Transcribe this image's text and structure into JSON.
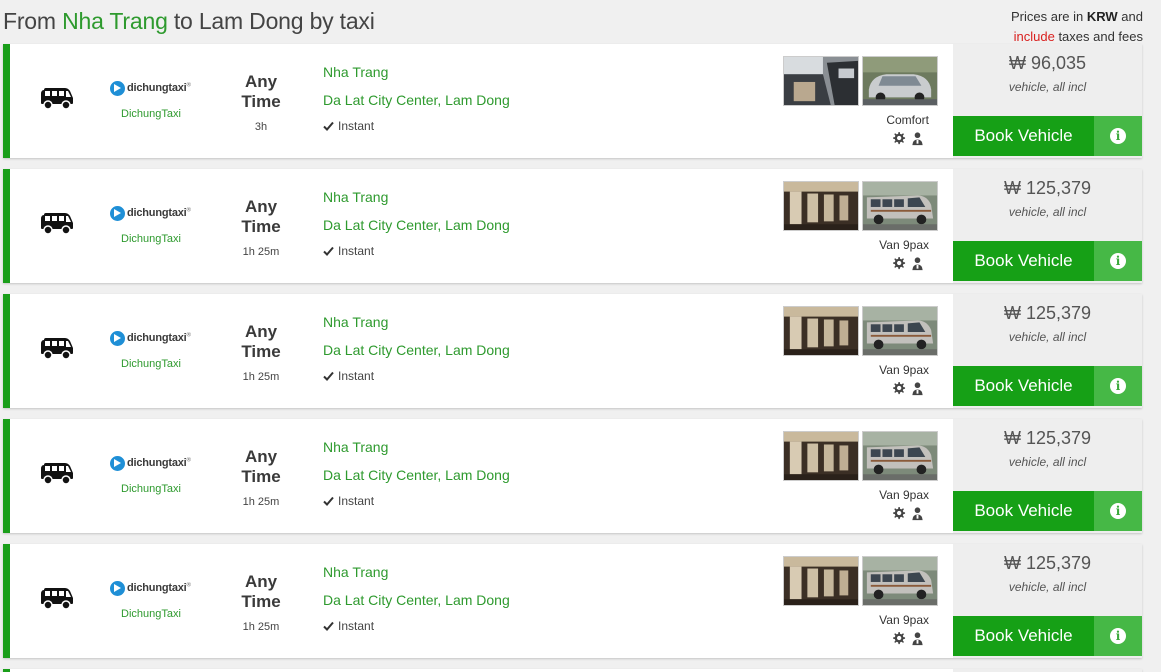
{
  "header": {
    "title_prefix": "From ",
    "origin": "Nha Trang",
    "title_middle": " to ",
    "destination": "Lam Dong",
    "title_suffix": " by taxi",
    "note_prefix": "Prices are in ",
    "currency": "KRW",
    "note_and": " and",
    "note_include": "include",
    "note_suffix": " taxes and fees"
  },
  "colors": {
    "accent_green": "#1a9e1a",
    "link_green": "#2e9a2e",
    "include_red": "#d9201f",
    "info_green": "#46b846"
  },
  "results": [
    {
      "operator_logo": "dichungtaxi",
      "operator_name": "DichungTaxi",
      "time_line1": "Any",
      "time_line2": "Time",
      "duration": "3h",
      "from": "Nha Trang",
      "to": "Da Lat City Center, Lam Dong",
      "instant": "Instant",
      "vehicle_class": "Comfort",
      "price": "₩ 96,035",
      "price_note": "vehicle, all incl",
      "book_label": "Book Vehicle",
      "photo1": "car-interior",
      "photo2": "sedan-exterior"
    },
    {
      "operator_logo": "dichungtaxi",
      "operator_name": "DichungTaxi",
      "time_line1": "Any",
      "time_line2": "Time",
      "duration": "1h 25m",
      "from": "Nha Trang",
      "to": "Da Lat City Center, Lam Dong",
      "instant": "Instant",
      "vehicle_class": "Van 9pax",
      "price": "₩ 125,379",
      "price_note": "vehicle, all incl",
      "book_label": "Book Vehicle",
      "photo1": "van-interior",
      "photo2": "van-exterior"
    },
    {
      "operator_logo": "dichungtaxi",
      "operator_name": "DichungTaxi",
      "time_line1": "Any",
      "time_line2": "Time",
      "duration": "1h 25m",
      "from": "Nha Trang",
      "to": "Da Lat City Center, Lam Dong",
      "instant": "Instant",
      "vehicle_class": "Van 9pax",
      "price": "₩ 125,379",
      "price_note": "vehicle, all incl",
      "book_label": "Book Vehicle",
      "photo1": "van-interior",
      "photo2": "van-exterior"
    },
    {
      "operator_logo": "dichungtaxi",
      "operator_name": "DichungTaxi",
      "time_line1": "Any",
      "time_line2": "Time",
      "duration": "1h 25m",
      "from": "Nha Trang",
      "to": "Da Lat City Center, Lam Dong",
      "instant": "Instant",
      "vehicle_class": "Van 9pax",
      "price": "₩ 125,379",
      "price_note": "vehicle, all incl",
      "book_label": "Book Vehicle",
      "photo1": "van-interior",
      "photo2": "van-exterior"
    },
    {
      "operator_logo": "dichungtaxi",
      "operator_name": "DichungTaxi",
      "time_line1": "Any",
      "time_line2": "Time",
      "duration": "1h 25m",
      "from": "Nha Trang",
      "to": "Da Lat City Center, Lam Dong",
      "instant": "Instant",
      "vehicle_class": "Van 9pax",
      "price": "₩ 125,379",
      "price_note": "vehicle, all incl",
      "book_label": "Book Vehicle",
      "photo1": "van-interior",
      "photo2": "van-exterior"
    }
  ]
}
